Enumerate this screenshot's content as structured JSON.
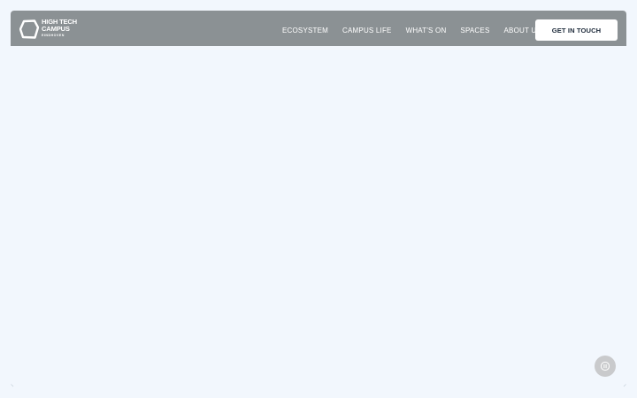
{
  "header": {
    "logo": {
      "line1": "HIGH TECH",
      "line2": "CAMPUS",
      "subline": "EINDHOVEN"
    },
    "nav": [
      {
        "label": "ECOSYSTEM"
      },
      {
        "label": "CAMPUS LIFE"
      },
      {
        "label": "WHAT'S ON"
      },
      {
        "label": "SPACES"
      },
      {
        "label": "ABOUT US"
      }
    ],
    "cta_label": "GET IN TOUCH"
  },
  "colors": {
    "page_background": "#f2f7fd",
    "navbar_background": "#8b9194",
    "cta_background": "#ffffff",
    "cta_text": "#1d2a3a",
    "pause_button_background": "#c9cacc"
  },
  "icons": {
    "logo": "hexagon-outline-icon",
    "pause": "pause-icon"
  }
}
